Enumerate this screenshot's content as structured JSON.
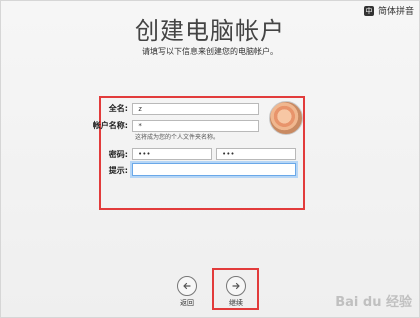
{
  "header": {
    "ime_label": "简体拼音",
    "ime_badge": "中",
    "title": "创建电脑帐户",
    "subtitle": "请填写以下信息来创建您的电脑帐户。"
  },
  "form": {
    "full_name": {
      "label": "全名:",
      "value": "z"
    },
    "account_name": {
      "label": "帐户名称:",
      "value": "*",
      "hint": "这将成为您的个人文件夹名称。"
    },
    "password": {
      "label": "密码:",
      "value": "•••",
      "verify_value": "•••"
    },
    "hint": {
      "label": "提示:",
      "value": ""
    }
  },
  "nav": {
    "back": {
      "label": "返回"
    },
    "continue": {
      "label": "继续"
    }
  },
  "watermark": {
    "text": "Bai du 经验"
  }
}
